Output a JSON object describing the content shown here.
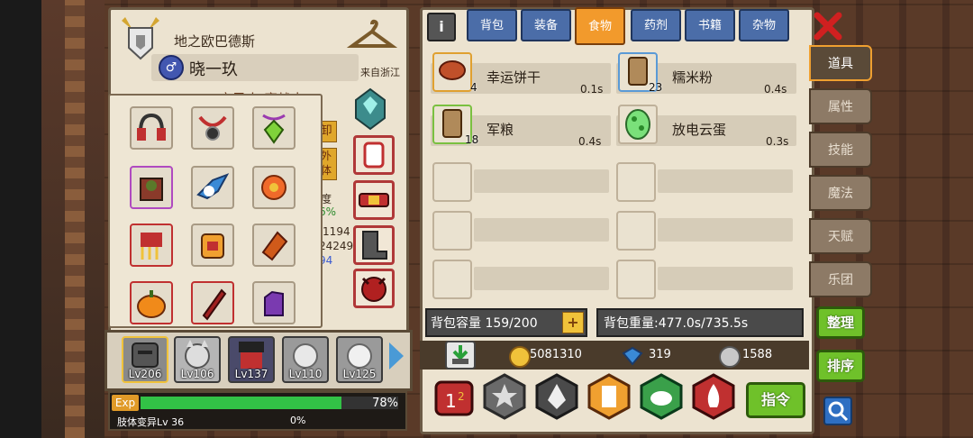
{
  "character": {
    "crest_title": "地之欧巴德斯",
    "name": "晓一玖",
    "origin": "来自浙江",
    "subtitle_partial": "变异人 魔战士",
    "peek": {
      "btn1": "卸",
      "btn2a": "外",
      "btn2b": "体",
      "degree": "度",
      "pct": "6%",
      "v1": "/1194",
      "v2": "24249",
      "v3": "94"
    }
  },
  "heroes": [
    {
      "level": "Lv206"
    },
    {
      "level": "Lv106"
    },
    {
      "level": "Lv137"
    },
    {
      "level": "Lv110"
    },
    {
      "level": "Lv125"
    }
  ],
  "exp": {
    "label": "Exp",
    "percent": "78%",
    "percent_value": 0.78,
    "sub_label": "肢体变异Lv 36",
    "sub_percent": "0%"
  },
  "tabs": [
    {
      "label": "背包",
      "active": false
    },
    {
      "label": "装备",
      "active": false
    },
    {
      "label": "食物",
      "active": true
    },
    {
      "label": "药剂",
      "active": false
    },
    {
      "label": "书籍",
      "active": false
    },
    {
      "label": "杂物",
      "active": false
    }
  ],
  "items": [
    {
      "name": "幸运饼干",
      "time": "0.1s",
      "count": "4",
      "icon": "cookie-icon"
    },
    {
      "name": "糯米粉",
      "time": "0.4s",
      "count": "23",
      "icon": "flour-bag-icon"
    },
    {
      "name": "军粮",
      "time": "0.4s",
      "count": "18",
      "icon": "ration-icon"
    },
    {
      "name": "放电云蛋",
      "time": "0.3s",
      "count": "",
      "icon": "egg-icon"
    }
  ],
  "capacity": {
    "label": "背包容量 159/200",
    "plus": "+"
  },
  "weight": {
    "label": "背包重量:477.0s/735.5s"
  },
  "currency": {
    "gold": "5081310",
    "diamond": "319",
    "silver": "1588"
  },
  "side_tabs": [
    {
      "label": "道具",
      "active": true
    },
    {
      "label": "属性",
      "active": false
    },
    {
      "label": "技能",
      "active": false
    },
    {
      "label": "魔法",
      "active": false
    },
    {
      "label": "天赋",
      "active": false
    },
    {
      "label": "乐团",
      "active": false
    }
  ],
  "buttons": {
    "sort": "整理",
    "order": "排序",
    "command": "指令",
    "info": "i"
  },
  "colors": {
    "tab_blue": "#4b6da8",
    "tab_active": "#f29a2c",
    "green_button": "#6fc12a",
    "exp_fill": "#32c246"
  }
}
